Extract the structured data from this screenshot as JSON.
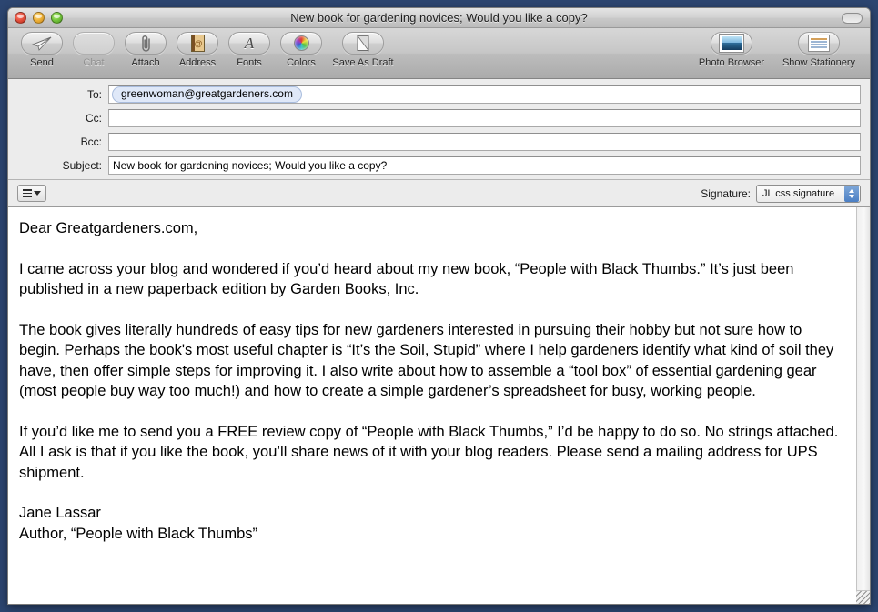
{
  "window": {
    "title": "New book for gardening novices; Would you like a copy?",
    "traffic_lights": [
      "close",
      "minimize",
      "zoom"
    ],
    "toolbar_toggle": "toolbar-toggle-pill",
    "background_color": "#2c4570"
  },
  "toolbar": {
    "left_items": [
      {
        "label": "Send",
        "icon": "paper-plane-icon",
        "disabled": false
      },
      {
        "label": "Chat",
        "icon": "chat-icon",
        "disabled": true
      },
      {
        "label": "Attach",
        "icon": "paperclip-icon",
        "disabled": false
      },
      {
        "label": "Address",
        "icon": "address-book-icon",
        "disabled": false
      },
      {
        "label": "Fonts",
        "icon": "font-a-icon",
        "disabled": false
      },
      {
        "label": "Colors",
        "icon": "color-wheel-icon",
        "disabled": false
      },
      {
        "label": "Save As Draft",
        "icon": "save-draft-icon",
        "disabled": false
      }
    ],
    "right_items": [
      {
        "label": "Photo Browser",
        "icon": "photo-browser-icon"
      },
      {
        "label": "Show Stationery",
        "icon": "stationery-icon"
      }
    ]
  },
  "headers": {
    "to": {
      "label": "To:",
      "recipients": [
        "greenwoman@greatgardeners.com"
      ]
    },
    "cc": {
      "label": "Cc:",
      "value": ""
    },
    "bcc": {
      "label": "Bcc:",
      "value": ""
    },
    "subject": {
      "label": "Subject:",
      "value": "New book for gardening novices; Would you like a copy?"
    }
  },
  "signature_bar": {
    "format_button_icon": "list-format-icon",
    "signature_label": "Signature:",
    "signature_selected": "JL css signature"
  },
  "message_body": {
    "paragraphs": [
      "Dear Greatgardeners.com,",
      "I came across your blog and wondered if you’d heard about my new book, “People with Black Thumbs.” It’s just been published in a new paperback edition by Garden Books, Inc.",
      "The book gives literally hundreds of easy tips for new gardeners interested in pursuing their hobby but not sure how to begin. Perhaps the book's most useful chapter is “It’s the Soil, Stupid” where I help gardeners identify what kind of soil they have, then offer simple steps for improving it. I also write about how to assemble a “tool box” of essential gardening gear (most people buy way too much!) and how to create a simple gardener’s spreadsheet for busy, working people.",
      "If you’d like me to send you a FREE review copy of “People with Black Thumbs,” I’d be happy to do so. No strings attached. All I ask is that if you like the book, you’ll share news of it with your blog readers. Please send a mailing address for UPS shipment."
    ],
    "signature_lines": [
      "Jane Lassar",
      "Author, “People with Black Thumbs”"
    ]
  }
}
